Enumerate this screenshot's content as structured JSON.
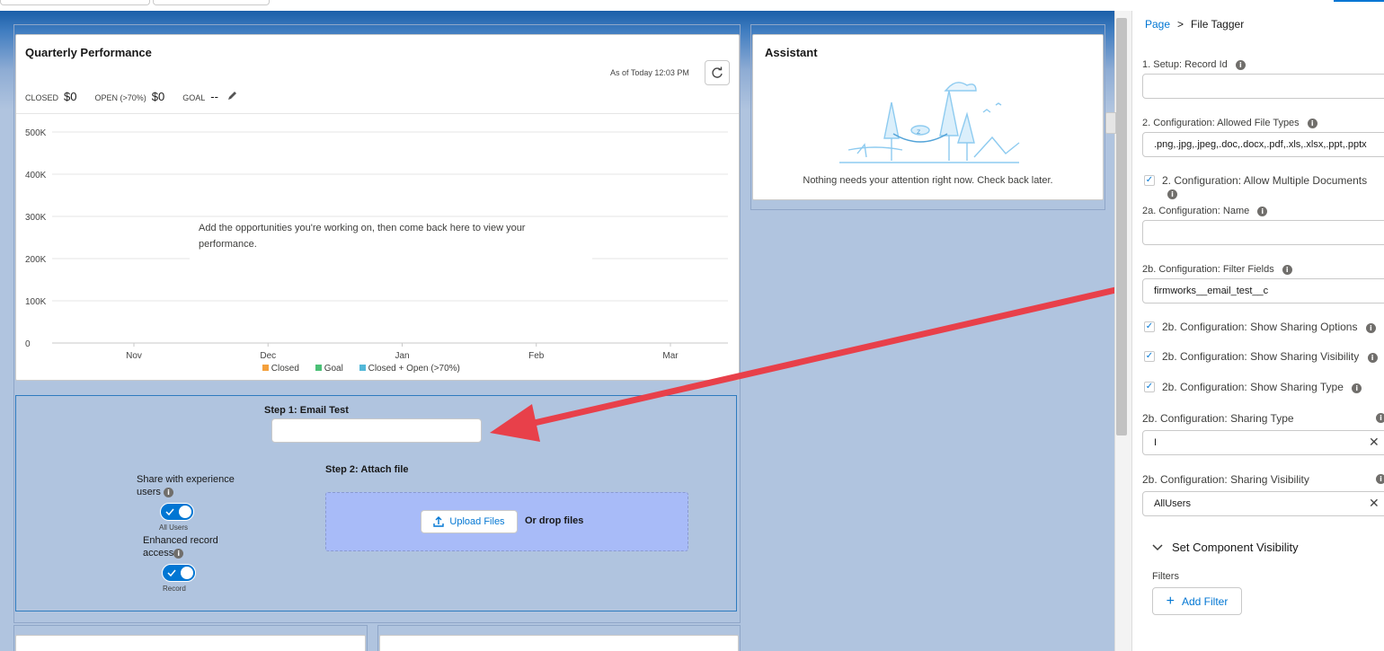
{
  "colors": {
    "brand": "#0176d3",
    "arrow": "#e8404a",
    "canvas": "#b0c4df",
    "dropzone": "#a8bbf8"
  },
  "quarterly": {
    "title": "Quarterly Performance",
    "as_of": "As of Today 12:03 PM",
    "closed_label": "CLOSED",
    "closed_value": "$0",
    "open_label": "OPEN (>70%)",
    "open_value": "$0",
    "goal_label": "GOAL",
    "goal_value": "--",
    "empty_msg_1": "Add the opportunities you're working on, then come back here to view your",
    "empty_msg_2": "performance.",
    "legend": [
      "Closed",
      "Goal",
      "Closed + Open (>70%)"
    ]
  },
  "chart_data": {
    "type": "line",
    "x": [
      "Nov",
      "Dec",
      "Jan",
      "Feb",
      "Mar"
    ],
    "yticks": [
      "500Κ",
      "400Κ",
      "300Κ",
      "200Κ",
      "100Κ",
      "0"
    ],
    "ylim": [
      0,
      500000
    ],
    "series": [
      {
        "name": "Closed",
        "values": []
      },
      {
        "name": "Goal",
        "values": []
      },
      {
        "name": "Closed + Open (>70%)",
        "values": []
      }
    ],
    "legend_colors": [
      "#f4a03c",
      "#4bc076",
      "#52b7d8"
    ],
    "grid": true,
    "legend_position": "bottom"
  },
  "assistant": {
    "title": "Assistant",
    "message": "Nothing needs your attention right now. Check back later."
  },
  "tagger": {
    "step1": "Step 1: Email Test",
    "email_value": "",
    "step2": "Step 2: Attach file",
    "upload_label": "Upload Files",
    "drop_label": "Or drop files",
    "share_label_1": "Share with experience",
    "share_label_2": "users",
    "share_toggle_caption": "All Users",
    "share_on": true,
    "enhanced_label_1": "Enhanced record",
    "enhanced_label_2": "access",
    "enhanced_toggle_caption": "Record",
    "enhanced_on": true
  },
  "panel": {
    "breadcrumb_page": "Page",
    "breadcrumb_sep": ">",
    "breadcrumb_current": "File Tagger",
    "record_id_label": "1. Setup: Record Id",
    "record_id_value": "",
    "file_types_label": "2. Configuration: Allowed File Types",
    "file_types_value": ".png,.jpg,.jpeg,.doc,.docx,.pdf,.xls,.xlsx,.ppt,.pptx",
    "allow_multi_label": "2. Configuration: Allow Multiple Documents",
    "allow_multi_checked": true,
    "name_label": "2a. Configuration: Name",
    "name_value": "",
    "filter_fields_label": "2b. Configuration: Filter Fields",
    "filter_fields_value": "firmworks__email_test__c",
    "show_opts_label": "2b. Configuration: Show Sharing Options",
    "show_vis_label": "2b. Configuration: Show Sharing Visibility",
    "show_type_label": "2b. Configuration: Show Sharing Type",
    "sharing_type_label": "2b. Configuration: Sharing Type",
    "sharing_type_value": "I",
    "sharing_vis_label": "2b. Configuration: Sharing Visibility",
    "sharing_vis_value": "AllUsers",
    "visibility_section": "Set Component Visibility",
    "filters_label": "Filters",
    "add_filter_label": "Add Filter"
  }
}
